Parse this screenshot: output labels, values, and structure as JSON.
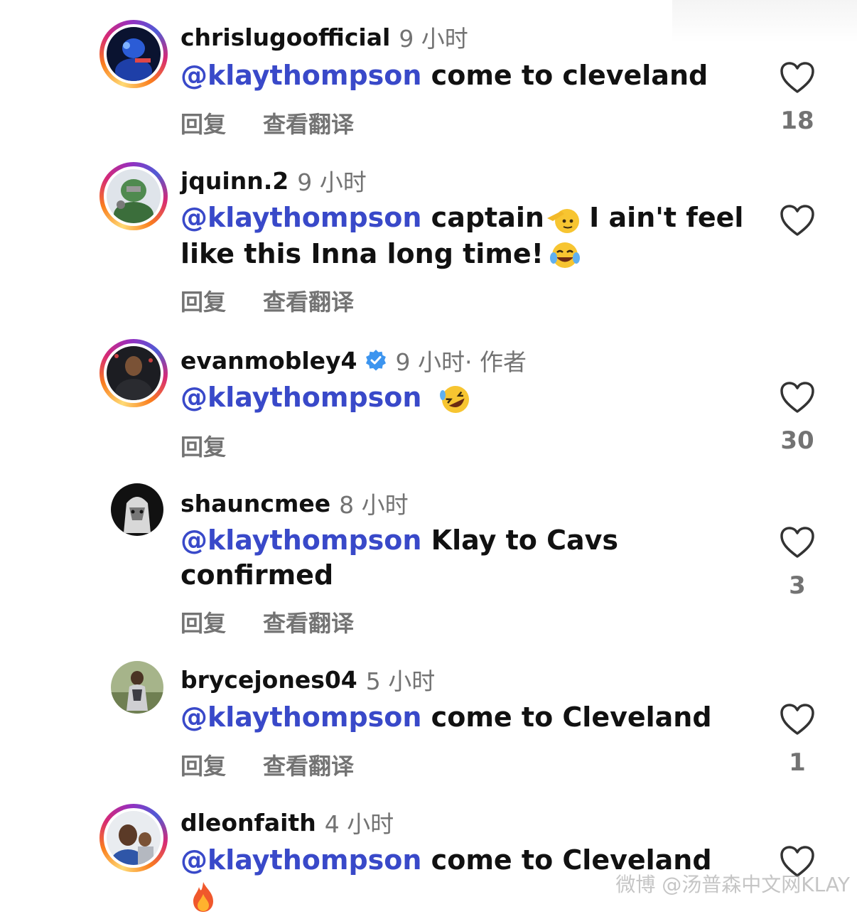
{
  "comments": [
    {
      "username": "chrislugoofficial",
      "time": "9 小时",
      "verified": false,
      "author_tag": "",
      "mention": "@klaythompson",
      "text": " come to cleveland",
      "text_line2": "",
      "emoji": "",
      "reply_label": "回复",
      "translate_label": "查看翻译",
      "likes": "18",
      "avatar_style": "story-ring"
    },
    {
      "username": "jquinn.2",
      "time": "9 小时",
      "verified": false,
      "author_tag": "",
      "mention": "@klaythompson",
      "text": " captain",
      "text_after_emoji": " I ain't feel",
      "text_line2": "like this Inna long time!",
      "emoji": "saluting-face",
      "emoji2": "tears-of-joy",
      "reply_label": "回复",
      "translate_label": "查看翻译",
      "likes": "",
      "avatar_style": "story-ring"
    },
    {
      "username": "evanmobley4",
      "time": "9 小时",
      "verified": true,
      "author_tag": " · 作者",
      "mention": "@klaythompson",
      "text": "",
      "text_line2": "",
      "emoji": "rolling-on-floor-laughing",
      "reply_label": "回复",
      "translate_label": "",
      "likes": "30",
      "avatar_style": "story-ring"
    },
    {
      "username": "shauncmee",
      "time": "8 小时",
      "verified": false,
      "author_tag": "",
      "mention": "@klaythompson",
      "text": " Klay to Cavs",
      "text_line2": "confirmed",
      "emoji": "",
      "reply_label": "回复",
      "translate_label": "查看翻译",
      "likes": "3",
      "avatar_style": "plain"
    },
    {
      "username": "brycejones04",
      "time": "5 小时",
      "verified": false,
      "author_tag": "",
      "mention": "@klaythompson",
      "text": " come to Cleveland",
      "text_line2": "",
      "emoji": "",
      "reply_label": "回复",
      "translate_label": "查看翻译",
      "likes": "1",
      "avatar_style": "plain"
    },
    {
      "username": "dleonfaith",
      "time": "4 小时",
      "verified": false,
      "author_tag": "",
      "mention": "@klaythompson",
      "text": " come to Cleveland",
      "text_line2": "",
      "emoji": "fire",
      "reply_label": "",
      "translate_label": "",
      "likes": "",
      "avatar_style": "story-ring"
    }
  ],
  "watermark": "微博 @汤普森中文网KLAY",
  "colors": {
    "mention": "#3949c9",
    "muted": "#737373",
    "text": "#111111"
  },
  "icons": {
    "like": "heart-outline-icon",
    "verified": "verified-badge-icon"
  }
}
